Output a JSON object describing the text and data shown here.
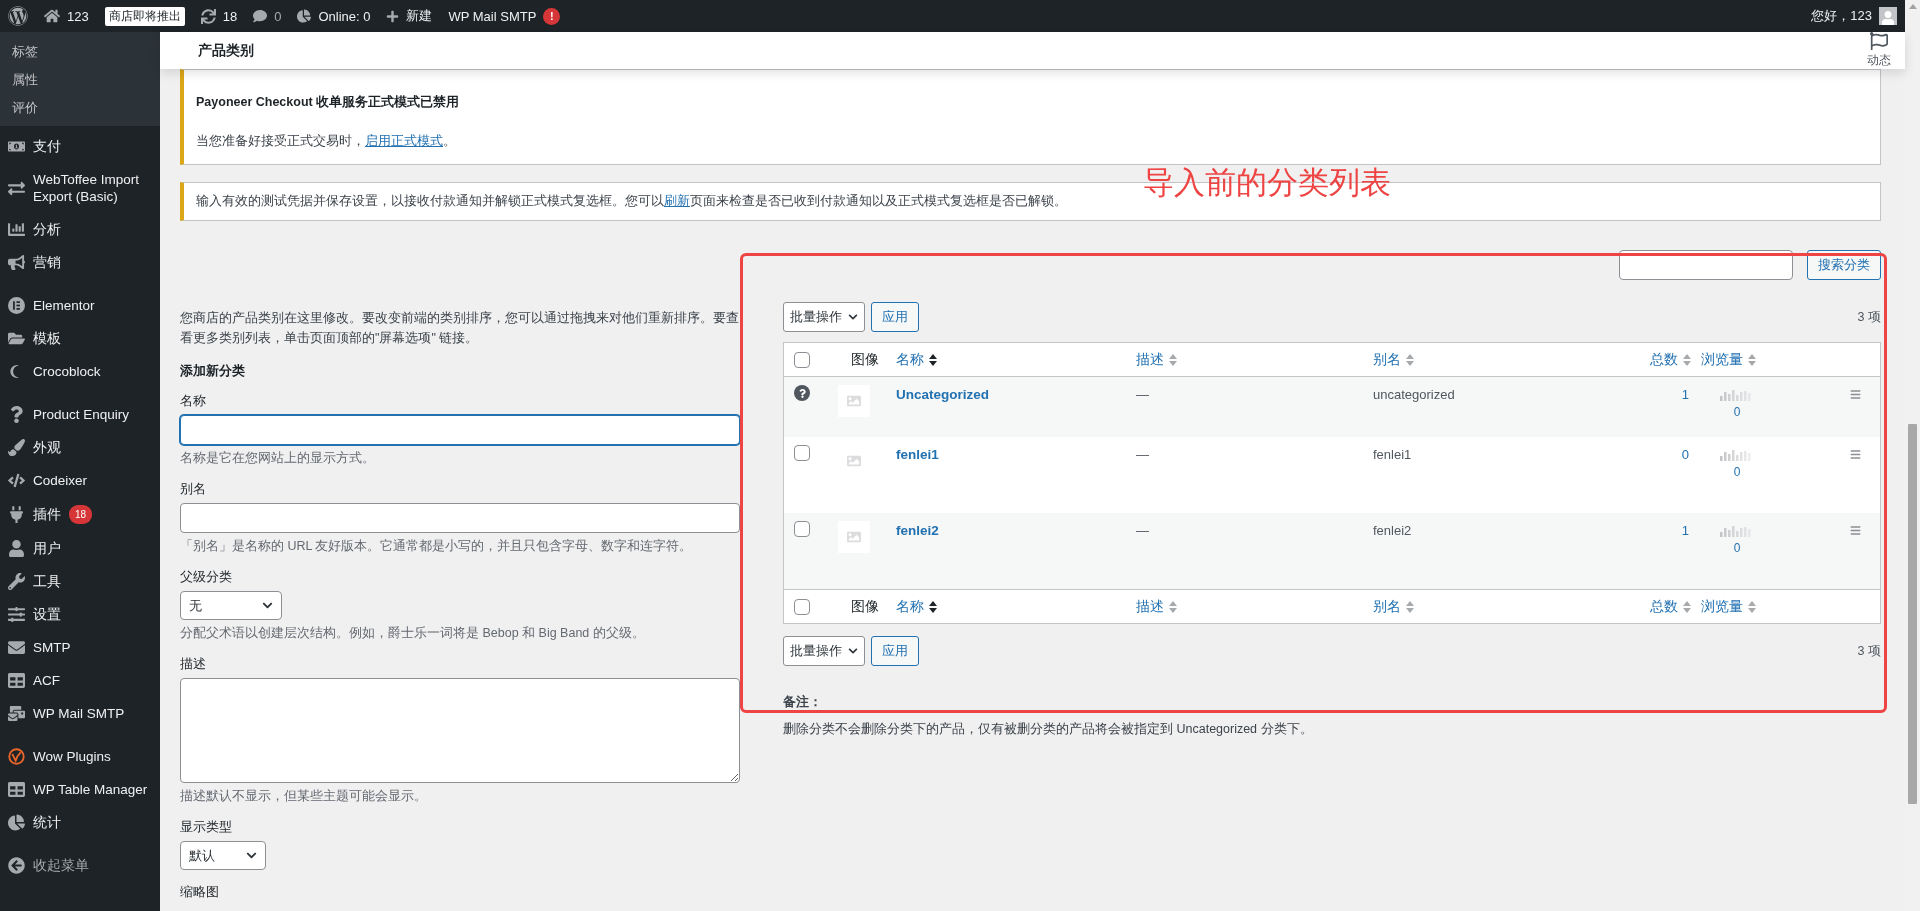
{
  "admin_bar": {
    "site": "123",
    "badge": "商店即将推出",
    "updates": "18",
    "comments": "0",
    "online": "Online: 0",
    "new": "新建",
    "smtp": "WP Mail SMTP",
    "smtp_alert": "!",
    "greeting": "您好，123"
  },
  "sidebar": {
    "sub_items": [
      {
        "label": "标签"
      },
      {
        "label": "属性"
      },
      {
        "label": "评价"
      }
    ],
    "groups": [
      [
        {
          "label": "支付"
        },
        {
          "label": "WebToffee Import Export (Basic)"
        },
        {
          "label": "分析"
        },
        {
          "label": "营销"
        }
      ],
      [
        {
          "label": "Elementor"
        },
        {
          "label": "模板"
        },
        {
          "label": "Crocoblock"
        }
      ],
      [
        {
          "label": "Product Enquiry"
        },
        {
          "label": "外观"
        },
        {
          "label": "Codeixer"
        },
        {
          "label": "插件",
          "badge": "18"
        },
        {
          "label": "用户"
        },
        {
          "label": "工具"
        },
        {
          "label": "设置"
        },
        {
          "label": "SMTP"
        },
        {
          "label": "ACF"
        },
        {
          "label": "WP Mail SMTP"
        }
      ],
      [
        {
          "label": "Wow Plugins"
        },
        {
          "label": "WP Table Manager"
        },
        {
          "label": "统计"
        }
      ]
    ],
    "collapse": "收起菜单"
  },
  "header": {
    "title": "产品类别",
    "activity": "动态"
  },
  "notices": [
    {
      "title": "Payoneer Checkout 收单服务正式模式已禁用",
      "text_before": "当您准备好接受正式交易时，",
      "link": "启用正式模式",
      "text_after": "。"
    },
    {
      "text_before": "输入有效的测试凭据并保存设置，以接收付款通知并解锁正式模式复选框。您可以",
      "link": "刷新",
      "text_after": "页面来检查是否已收到付款通知以及正式模式复选框是否已解锁。"
    }
  ],
  "search": {
    "button": "搜索分类"
  },
  "form": {
    "intro": "您商店的产品类别在这里修改。要改变前端的类别排序，您可以通过拖拽来对他们重新排序。要查看更多类别列表，单击页面顶部的\"屏幕选项\" 链接。",
    "heading": "添加新分类",
    "fields": [
      {
        "kind": "text",
        "label": "名称",
        "hint": "名称是它在您网站上的显示方式。",
        "focused": true
      },
      {
        "kind": "text",
        "label": "别名",
        "hint": "「别名」是名称的 URL 友好版本。它通常都是小写的，并且只包含字母、数字和连字符。",
        "focused": false
      },
      {
        "kind": "select",
        "label": "父级分类",
        "value": "无",
        "hint": "分配父术语以创建层次结构。例如，爵士乐一词将是 Bebop 和 Big Band 的父级。"
      },
      {
        "kind": "textarea",
        "label": "描述",
        "hint": "描述默认不显示，但某些主题可能会显示。"
      },
      {
        "kind": "select",
        "label": "显示类型",
        "value": "默认"
      },
      {
        "kind": "label",
        "label": "缩略图"
      }
    ]
  },
  "table": {
    "bulk_action": "批量操作",
    "apply": "应用",
    "count": "3 项",
    "header_checked": false,
    "header_columns": [
      {
        "label": "图像",
        "sortable": false
      },
      {
        "label": "名称",
        "sortable": true,
        "sorted": true
      },
      {
        "label": "描述",
        "sortable": true,
        "sorted": false
      },
      {
        "label": "别名",
        "sortable": true,
        "sorted": false
      },
      {
        "label": "总数",
        "sortable": true,
        "sorted": false
      },
      {
        "label": "浏览量",
        "sortable": true,
        "sorted": false
      }
    ],
    "rows": [
      {
        "kind": "default",
        "name": "Uncategorized",
        "description": "—",
        "slug": "uncategorized",
        "count": "1",
        "views": "0"
      },
      {
        "kind": "normal",
        "checked": false,
        "name": "fenlei1",
        "description": "—",
        "slug": "fenlei1",
        "count": "0",
        "views": "0"
      },
      {
        "kind": "normal",
        "checked": false,
        "name": "fenlei2",
        "description": "—",
        "slug": "fenlei2",
        "count": "1",
        "views": "0"
      }
    ],
    "footer_checked": false,
    "footer_columns": [
      {
        "label": "图像",
        "sortable": false
      },
      {
        "label": "名称",
        "sortable": true,
        "sorted": true
      },
      {
        "label": "描述",
        "sortable": true,
        "sorted": false
      },
      {
        "label": "别名",
        "sortable": true,
        "sorted": false
      },
      {
        "label": "总数",
        "sortable": true,
        "sorted": false
      },
      {
        "label": "浏览量",
        "sortable": true,
        "sorted": false
      }
    ],
    "footer_bulk_action": "批量操作",
    "footer_apply": "应用",
    "footer_count": "3 项"
  },
  "note": {
    "title": "备注：",
    "text": "删除分类不会删除分类下的产品，仅有被删分类的产品将会被指定到 Uncategorized 分类下。"
  },
  "annotation": {
    "text": "导入前的分类列表"
  }
}
